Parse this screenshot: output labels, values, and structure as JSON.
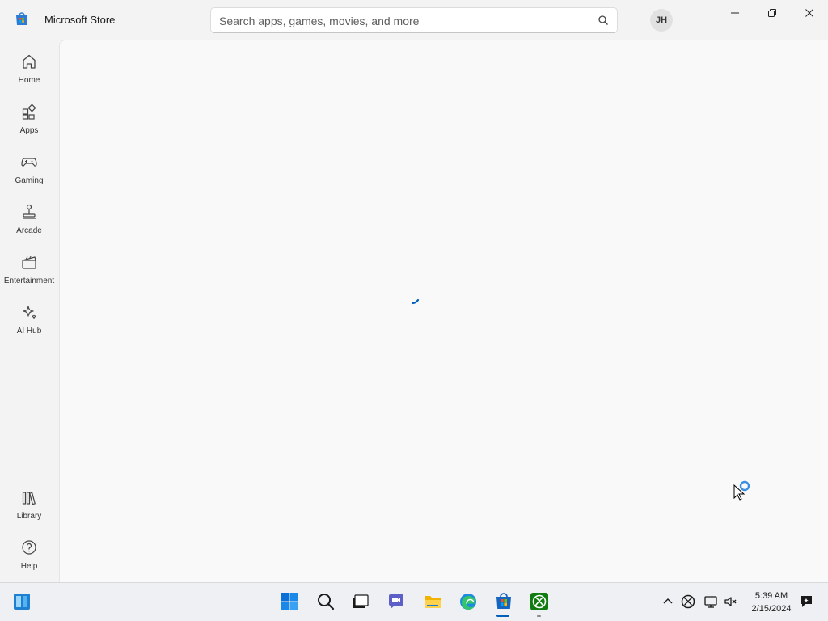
{
  "window": {
    "app_title": "Microsoft Store",
    "search_placeholder": "Search apps, games, movies, and more",
    "user_initials": "JH"
  },
  "sidebar": {
    "items": [
      {
        "label": "Home",
        "icon": "home-icon"
      },
      {
        "label": "Apps",
        "icon": "apps-icon"
      },
      {
        "label": "Gaming",
        "icon": "gamepad-icon"
      },
      {
        "label": "Arcade",
        "icon": "joystick-icon"
      },
      {
        "label": "Entertainment",
        "icon": "clapperboard-icon"
      },
      {
        "label": "AI Hub",
        "icon": "sparkle-icon"
      }
    ],
    "bottom_items": [
      {
        "label": "Library",
        "icon": "library-icon"
      },
      {
        "label": "Help",
        "icon": "help-icon"
      }
    ]
  },
  "content": {
    "state": "loading"
  },
  "taskbar": {
    "apps": [
      "widgets-icon",
      "start-icon",
      "search-icon",
      "task-view-icon",
      "chat-icon",
      "file-explorer-icon",
      "edge-icon",
      "store-icon",
      "xbox-icon"
    ],
    "active_app": "store-icon",
    "tray": [
      "chevron-up-icon",
      "xbox-tray-icon",
      "network-icon",
      "volume-icon",
      "notifications-icon"
    ],
    "time": "5:39 AM",
    "date": "2/15/2024"
  },
  "colors": {
    "accent": "#005fb8",
    "window_bg": "#f3f3f3",
    "content_bg": "#f9f9f9"
  }
}
